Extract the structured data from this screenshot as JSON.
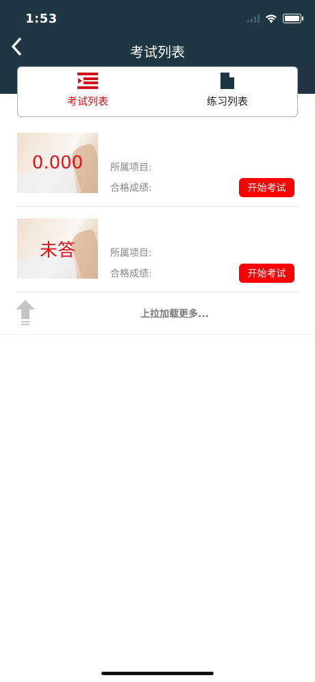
{
  "status_bar": {
    "time": "1:53"
  },
  "nav": {
    "title": "考试列表"
  },
  "tabs": [
    {
      "label": "考试列表",
      "active": true,
      "icon": "list-icon"
    },
    {
      "label": "练习列表",
      "active": false,
      "icon": "document-icon"
    }
  ],
  "items": [
    {
      "score": "0.000",
      "project_label": "所属项目:",
      "pass_label": "合格成绩:",
      "button": "开始考试"
    },
    {
      "score": "未答",
      "project_label": "所属项目:",
      "pass_label": "合格成绩:",
      "button": "开始考试"
    }
  ],
  "load_more": {
    "text": "上拉加载更多..."
  },
  "colors": {
    "header": "#1f3743",
    "accent_red": "#fe0000",
    "active_tab": "#d0101a"
  }
}
